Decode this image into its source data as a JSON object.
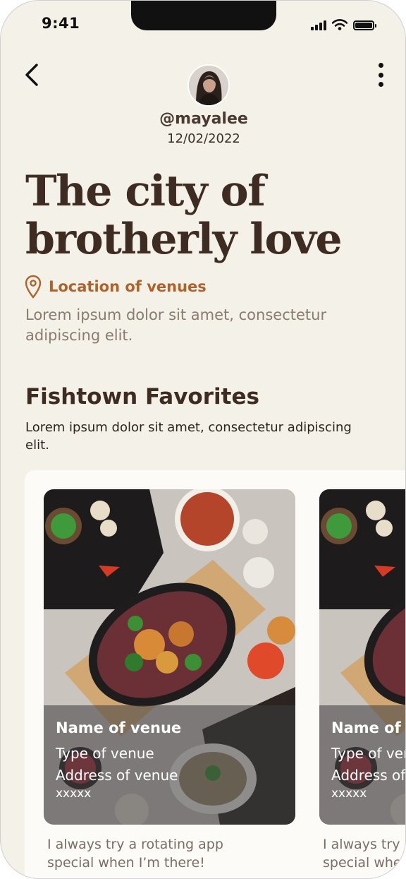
{
  "status_bar": {
    "time": "9:41",
    "icons": [
      "signal-icon",
      "wifi-icon",
      "battery-icon"
    ]
  },
  "header": {
    "back_icon": "chevron-left-icon",
    "more_icon": "more-vertical-icon",
    "username": "@mayalee",
    "date": "12/02/2022"
  },
  "post": {
    "title": "The city of brotherly love",
    "location_label": "Location of venues",
    "description": "Lorem ipsum dolor sit amet, consectetur adipiscing elit."
  },
  "section": {
    "title": "Fishtown Favorites",
    "description": "Lorem ipsum dolor sit amet, consectetur adipiscing elit.",
    "cards": [
      {
        "name": "Name of venue",
        "type": "Type of venue",
        "address": "Address of venue",
        "extra": "xxxxx",
        "quote": "I always try a rotating app special when I’m there!"
      },
      {
        "name": "Name of venue",
        "type": "Type of venue",
        "address": "Address of venue",
        "extra": "xxxxx",
        "quote": "I always try a rotating app special when I’m there!"
      }
    ]
  },
  "colors": {
    "background": "#f4f2e8",
    "title": "#3e2c23",
    "accent": "#b0622c",
    "body_text": "#8a7a70"
  }
}
